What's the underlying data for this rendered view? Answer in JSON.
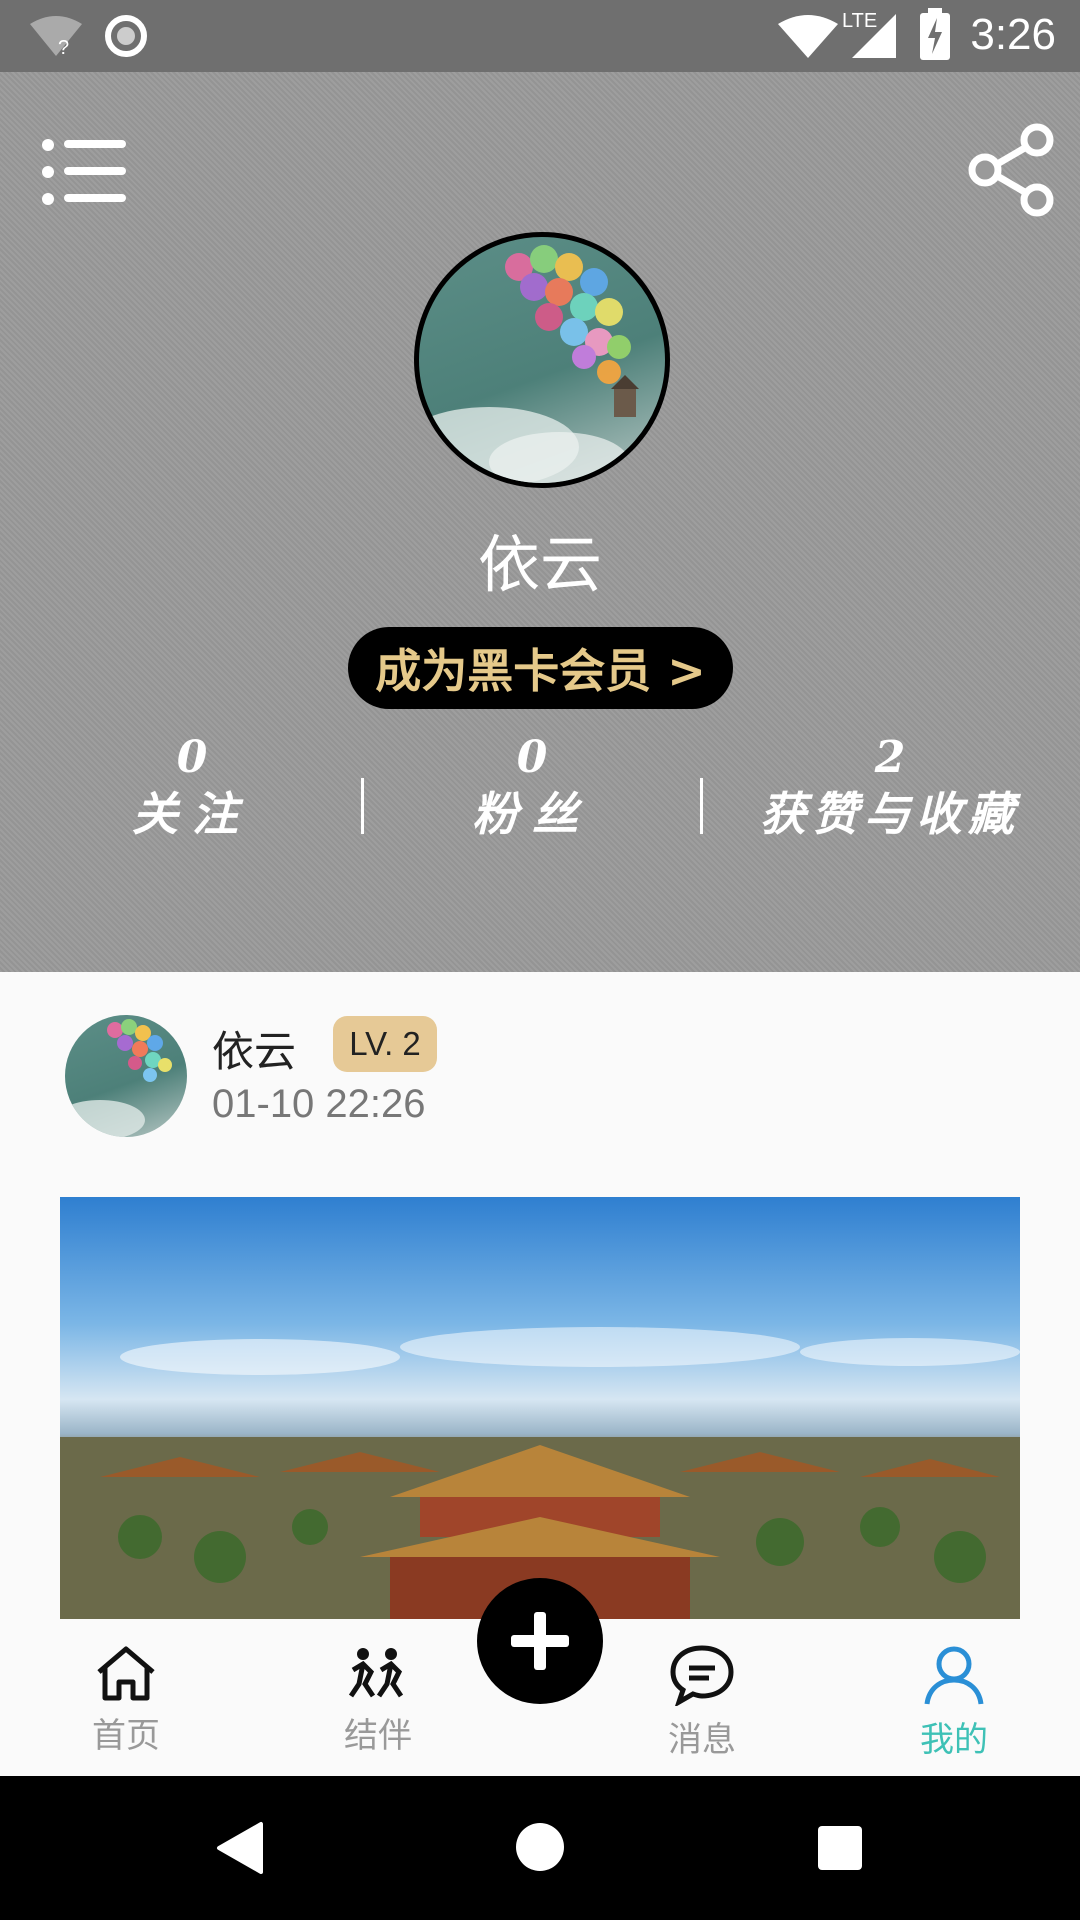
{
  "status_bar": {
    "time": "3:26",
    "network_label": "LTE",
    "icons": [
      "wifi-unknown-icon",
      "circle-indicator-icon",
      "wifi-icon",
      "signal-icon",
      "battery-charging-icon"
    ]
  },
  "header": {
    "menu_icon": "list-menu-icon",
    "share_icon": "share-icon",
    "username": "依云",
    "vip_label": "成为黑卡会员 >",
    "stats": [
      {
        "value": "0",
        "label": "关注"
      },
      {
        "value": "0",
        "label": "粉丝"
      },
      {
        "value": "2",
        "label": "获赞与收藏"
      }
    ]
  },
  "post": {
    "username": "依云",
    "level": "LV. 2",
    "time": "01-10 22:26"
  },
  "bottom_nav": {
    "items": [
      {
        "label": "首页",
        "icon": "home-icon"
      },
      {
        "label": "结伴",
        "icon": "companions-icon"
      },
      {
        "label": "消息",
        "icon": "message-icon"
      },
      {
        "label": "我的",
        "icon": "profile-icon"
      }
    ],
    "active": "我的",
    "fab_icon": "plus-icon"
  },
  "colors": {
    "header_bg": "#9a9a9a",
    "vip_text": "#e5c98a",
    "level_badge": "#e6c996",
    "active_tab": "#3ec1b6"
  }
}
